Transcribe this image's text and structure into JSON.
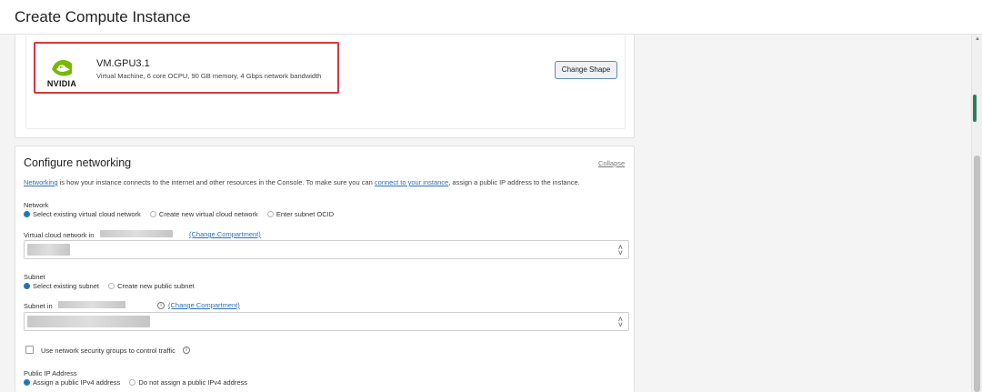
{
  "window": {
    "title": "Create Compute Instance"
  },
  "shape": {
    "vendor_logo_text": "NVIDIA",
    "name": "VM.GPU3.1",
    "description": "Virtual Machine, 6 core OCPU, 90 GB memory, 4 Gbps network bandwidth",
    "change_button": "Change Shape"
  },
  "networking": {
    "title": "Configure networking",
    "collapse": "Collapse",
    "intro_link": "Networking",
    "intro_text_1": " is how your instance connects to the internet and other resources in the Console. To make sure you can ",
    "intro_link_2": "connect to your instance",
    "intro_text_2": ", assign a public IP address to the instance.",
    "network_label": "Network",
    "network_options": [
      "Select existing virtual cloud network",
      "Create new virtual cloud network",
      "Enter subnet OCID"
    ],
    "vcn_label": "Virtual cloud network in",
    "change_compartment": "(Change Compartment)",
    "subnet_label": "Subnet",
    "subnet_options": [
      "Select existing subnet",
      "Create new public subnet"
    ],
    "subnet_in_label": "Subnet in",
    "nsg_label": "Use network security groups to control traffic",
    "public_ip_label": "Public IP Address",
    "public_ip_options": [
      "Assign a public IPv4 address",
      "Do not assign a public IPv4 address"
    ]
  },
  "colors": {
    "accent": "#1f6fb5",
    "highlight": "#d9363e",
    "nvidia_green": "#76b900"
  }
}
